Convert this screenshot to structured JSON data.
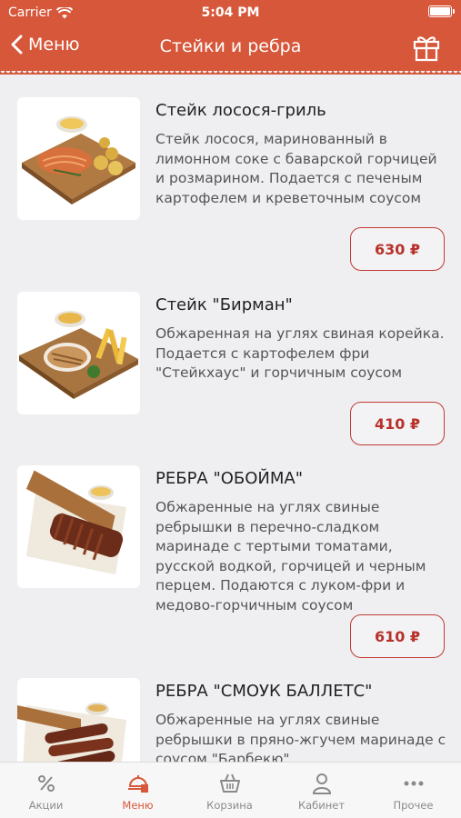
{
  "status": {
    "carrier": "Carrier",
    "time": "5:04 PM"
  },
  "nav": {
    "back_label": "Меню",
    "title": "Стейки и ребра"
  },
  "items": [
    {
      "title": "Стейк лосося-гриль",
      "description": "Стейк лосося, маринованный в лимонном соке с баварской горчицей и розмарином. Подается с печеным картофелем и креветочным соусом",
      "price": "630 ₽"
    },
    {
      "title": "Стейк \"Бирман\"",
      "description": "Обжаренная на углях свиная корейка. Подается с картофелем фри \"Стейкхаус\" и горчичным соусом",
      "price": "410 ₽"
    },
    {
      "title": "РЕБРА \"ОБОЙМА\"",
      "description": "Обжаренные на углях свиные ребрышки в перечно-сладком маринаде с тертыми томатами, русской водкой, горчицей и черным перцем. Подаются с луком-фри и медово-горчичным соусом",
      "price": "610 ₽"
    },
    {
      "title": "РЕБРА \"СМОУК БАЛЛЕТС\"",
      "description": "Обжаренные на углях свиные ребрышки в пряно-жгучем маринаде с соусом \"Барбекю\",",
      "price": ""
    }
  ],
  "tabs": [
    {
      "label": "Акции",
      "icon": "percent-icon"
    },
    {
      "label": "Меню",
      "icon": "menu-tray-icon",
      "active": true
    },
    {
      "label": "Корзина",
      "icon": "basket-icon"
    },
    {
      "label": "Кабинет",
      "icon": "user-icon"
    },
    {
      "label": "Прочее",
      "icon": "more-dots-icon"
    }
  ],
  "colors": {
    "accent": "#d7573a",
    "price": "#b8322b",
    "background": "#efeff2"
  }
}
